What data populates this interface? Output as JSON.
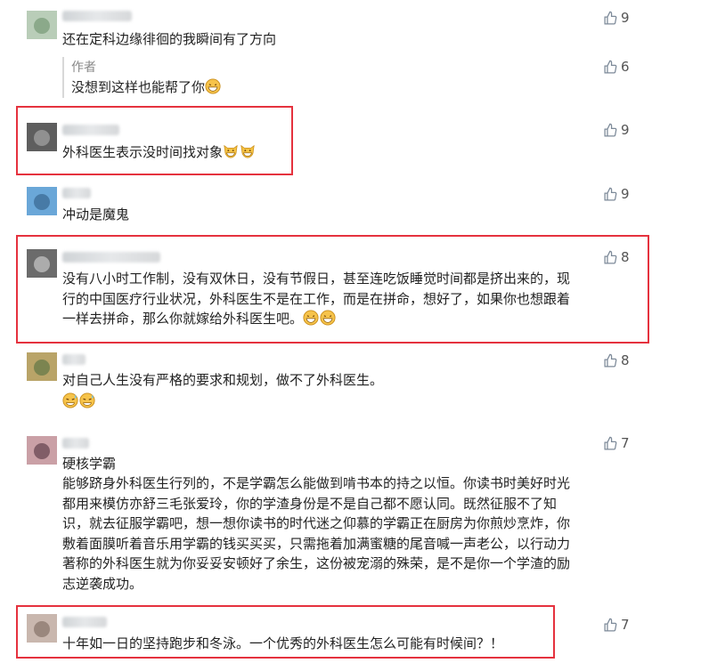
{
  "colors": {
    "highlight": "#e5323e",
    "like_icon": "#7d8a99",
    "text": "#222222"
  },
  "comments": [
    {
      "text": "还在定科边缘徘徊的我瞬间有了方向",
      "likes": "9"
    },
    {
      "reply_label": "作者",
      "text": "没想到这样也能帮了你",
      "likes": "6",
      "emoji": [
        "grin-emoji"
      ]
    },
    {
      "text": "外科医生表示没时间找对象",
      "likes": "9",
      "emoji": [
        "cat-emoji",
        "cat-emoji"
      ]
    },
    {
      "text": "冲动是魔鬼",
      "likes": "9"
    },
    {
      "lines": [
        "没有八小时工作制，没有双休日，没有节假日，甚至连吃饭睡觉时间都是挤出来的，现",
        "行的中国医疗行业状况，外科医生不是在工作，而是在拼命，想好了，如果你也想跟着",
        "一样去拼命，那么你就嫁给外科医生吧。"
      ],
      "likes": "8",
      "emoji": [
        "grin-emoji",
        "grin-emoji"
      ]
    },
    {
      "text": "对自己人生没有严格的要求和规划，做不了外科医生。",
      "likes": "8",
      "emoji": [
        "sweat-emoji",
        "sweat-emoji"
      ]
    },
    {
      "nickname": "硬核学霸",
      "lines": [
        "能够跻身外科医生行列的，不是学霸怎么能做到啃书本的持之以恒。你读书时美好时光",
        "都用来模仿亦舒三毛张爱玲，你的学渣身份是不是自己都不愿认同。既然征服不了知",
        "识，就去征服学霸吧，想一想你读书的时代迷之仰慕的学霸正在厨房为你煎炒烹炸，你",
        "敷着面膜听着音乐用学霸的钱买买买，只需拖着加满蜜糖的尾音喊一声老公，以行动力",
        "著称的外科医生就为你妥妥安顿好了余生，这份被宠溺的殊荣，是不是你一个学渣的励",
        "志逆袭成功。"
      ],
      "likes": "7"
    },
    {
      "text": "十年如一日的坚持跑步和冬泳。一个优秀的外科医生怎么可能有时候间？！",
      "likes": "7"
    }
  ]
}
